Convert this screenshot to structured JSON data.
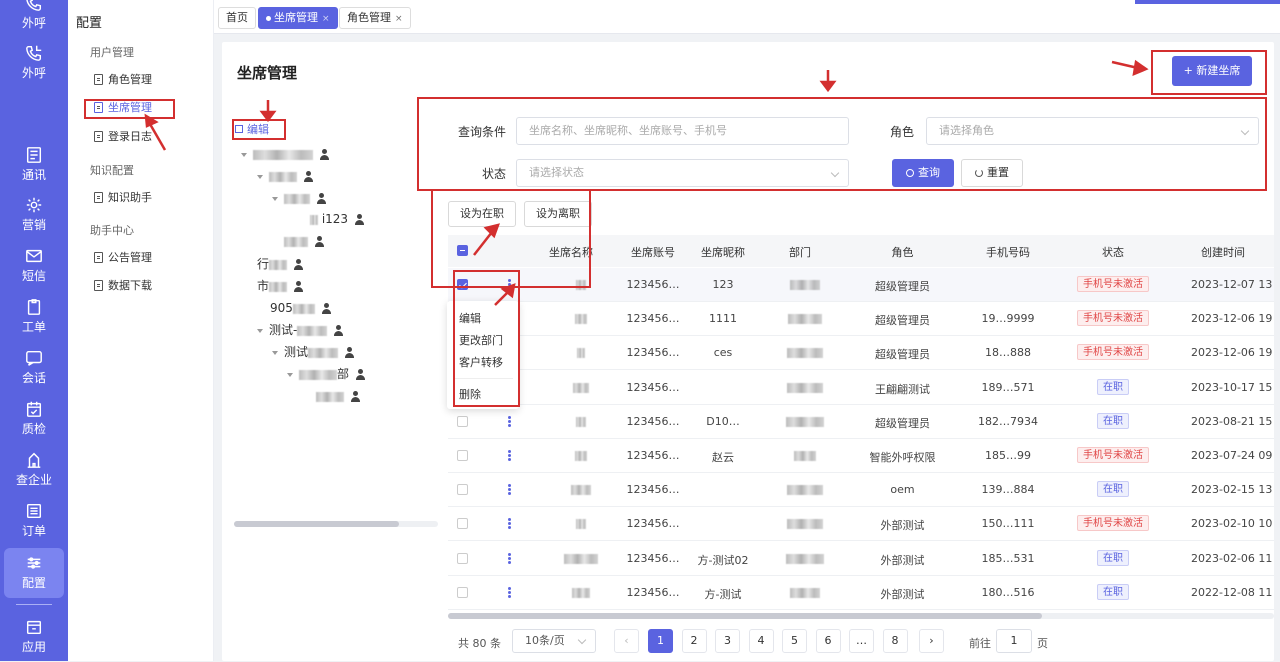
{
  "nav": {
    "items": [
      {
        "label": "外呼",
        "icon": "phone-out-icon"
      },
      {
        "label": "外呼",
        "icon": "phone-callback-icon"
      },
      {
        "label": "通讯",
        "icon": "contacts-icon"
      },
      {
        "label": "营销",
        "icon": "megaphone-icon"
      },
      {
        "label": "短信",
        "icon": "envelope-icon"
      },
      {
        "label": "工单",
        "icon": "clipboard-icon"
      },
      {
        "label": "会话",
        "icon": "chat-icon"
      },
      {
        "label": "质检",
        "icon": "calendar-check-icon"
      },
      {
        "label": "查企业",
        "icon": "building-icon"
      },
      {
        "label": "订单",
        "icon": "list-icon"
      },
      {
        "label": "配置",
        "icon": "sliders-icon"
      },
      {
        "label": "应用",
        "icon": "store-icon"
      }
    ],
    "active_index": 10
  },
  "sidebar": {
    "title": "配置",
    "groups": [
      "用户管理",
      "知识配置",
      "助手中心"
    ],
    "items": [
      "角色管理",
      "坐席管理",
      "登录日志",
      "知识助手",
      "公告管理",
      "数据下载"
    ]
  },
  "tabs": [
    {
      "label": "首页"
    },
    {
      "label": "坐席管理",
      "close": "×"
    },
    {
      "label": "角色管理",
      "close": "×"
    }
  ],
  "page": {
    "title": "坐席管理",
    "new_button": "+ 新建坐席",
    "edit_link": "编辑"
  },
  "filters": {
    "query_label": "查询条件",
    "query_placeholder": "坐席名称、坐席昵称、坐席账号、手机号",
    "role_label": "角色",
    "role_placeholder": "请选择角色",
    "status_label": "状态",
    "status_placeholder": "请选择状态",
    "search_button": "查询",
    "reset_button": "重置"
  },
  "bulk": {
    "set_active": "设为在职",
    "set_left": "设为离职"
  },
  "tree": {
    "nodes": [
      "i123",
      "行",
      "市",
      "905",
      "测试-",
      "测试",
      "部"
    ]
  },
  "table": {
    "columns": [
      "坐席名称",
      "坐席账号",
      "坐席昵称",
      "部门",
      "角色",
      "手机号码",
      "状态",
      "创建时间"
    ],
    "rows": [
      {
        "account": "123456…",
        "nick": "123",
        "role": "超级管理员",
        "phone": "",
        "status": "手机号未激活",
        "status_type": "red",
        "time": "2023-12-07 13:"
      },
      {
        "account": "123456…",
        "nick": "1111",
        "role": "超级管理员",
        "phone": "19…9999",
        "status": "手机号未激活",
        "status_type": "red",
        "time": "2023-12-06 19:"
      },
      {
        "account": "123456…",
        "nick": "ces",
        "role": "超级管理员",
        "phone": "18…888",
        "status": "手机号未激活",
        "status_type": "red",
        "time": "2023-12-06 19:"
      },
      {
        "account": "123456…",
        "nick": "",
        "role": "王翩翩测试",
        "phone": "189…571",
        "status": "在职",
        "status_type": "blue",
        "time": "2023-10-17 15:"
      },
      {
        "account": "123456…",
        "nick": "D10…",
        "role": "超级管理员",
        "phone": "182…7934",
        "status": "在职",
        "status_type": "blue",
        "time": "2023-08-21 15:"
      },
      {
        "account": "123456…",
        "nick": "赵云",
        "role": "智能外呼权限",
        "phone": "185…99",
        "status": "手机号未激活",
        "status_type": "red",
        "time": "2023-07-24 09:"
      },
      {
        "account": "123456…",
        "nick": "",
        "role": "oem",
        "phone": "139…884",
        "status": "在职",
        "status_type": "blue",
        "time": "2023-02-15 13:"
      },
      {
        "account": "123456…",
        "nick": "",
        "role": "外部测试",
        "phone": "150…111",
        "status": "手机号未激活",
        "status_type": "red",
        "time": "2023-02-10 10:"
      },
      {
        "account": "123456…",
        "nick": "方-测试02",
        "role": "外部测试",
        "phone": "185…531",
        "status": "在职",
        "status_type": "blue",
        "time": "2023-02-06 11:"
      },
      {
        "account": "123456…",
        "nick": "方-测试",
        "role": "外部测试",
        "phone": "180…516",
        "status": "在职",
        "status_type": "blue",
        "time": "2022-12-08 11:"
      }
    ]
  },
  "row_menu": [
    "编辑",
    "更改部门",
    "客户转移",
    "删除"
  ],
  "pagination": {
    "total": "共 80 条",
    "page_size": "10条/页",
    "pages": [
      "1",
      "2",
      "3",
      "4",
      "5",
      "6",
      "…",
      "8"
    ],
    "current": "1",
    "goto_label": "前往",
    "goto_value": "1",
    "page_unit": "页"
  },
  "accent_color": "#5a63e0",
  "annotation_color": "#d32f2f"
}
